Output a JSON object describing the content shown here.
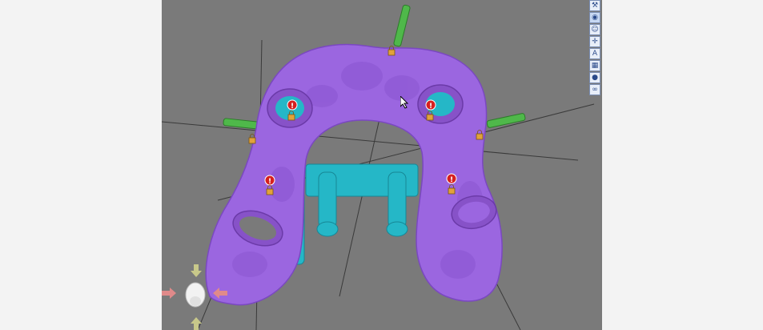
{
  "viewport": {
    "background": "#7a7a7a",
    "model_color": "#9b66e0",
    "support_color": "#25b7c7",
    "pin_color": "#4fb84a",
    "warning_color": "#d62020",
    "lock_color": "#e2a23a"
  },
  "toolbar": {
    "tools": [
      {
        "icon": "wrench-icon",
        "glyph": "⚒"
      },
      {
        "icon": "cube-view-icon",
        "glyph": "◉"
      },
      {
        "icon": "face-view-icon",
        "glyph": "☺"
      },
      {
        "icon": "crosshair-icon",
        "glyph": "✛"
      },
      {
        "icon": "text-tool-icon",
        "glyph": "A"
      },
      {
        "icon": "grid-icon",
        "glyph": "▦"
      },
      {
        "icon": "sphere-icon",
        "glyph": "●"
      },
      {
        "icon": "link-icon",
        "glyph": "∞"
      }
    ]
  },
  "markers": {
    "warning_glyph": "!",
    "lock_glyph": "🔒"
  }
}
